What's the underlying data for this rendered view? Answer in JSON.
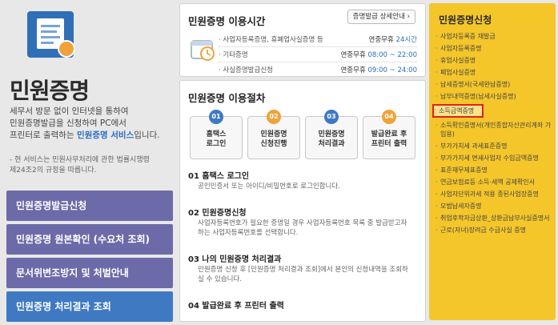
{
  "hero": {
    "title": "민원증명",
    "desc_1": "세무서 방문 없이 인터넷을 통하여",
    "desc_2": "민원증명발급을 신청하여 PC에서",
    "desc_3a": "프린터로 출력하는 ",
    "desc_3b": "민원증명 서비스",
    "desc_3c": "입니다.",
    "note_1": "- 현 서비스는 민원사무처리에 관한 법률시행령",
    "note_2": "  제24조2의 규정을 따릅니다."
  },
  "left_menu": [
    {
      "label": "민원증명발급신청"
    },
    {
      "label": "민원증명 원본확인 (수요처 조회)"
    },
    {
      "label": "문서위변조방지 및 처벌안내"
    },
    {
      "label": "민원증명 처리결과 조회"
    }
  ],
  "hours": {
    "title": "민원증명 이용시간",
    "detail_button": "증명발급 상세안내 ›",
    "rows": [
      {
        "label": "· 사업자등록증명, 휴폐업사실증명 등",
        "time_prefix": "연중무휴 ",
        "time": "24시간"
      },
      {
        "label": "· 기타증명",
        "time_prefix": "연중무휴 ",
        "time": "08:00 ~ 22:00"
      },
      {
        "label": "· 사실증명발급신청",
        "time_prefix": "연중무휴 ",
        "time": "09:00 ~ 24:00"
      }
    ]
  },
  "procedure": {
    "title": "민원증명 이용절차",
    "steps": [
      {
        "num": "01",
        "line1": "홈택스",
        "line2": "로그인"
      },
      {
        "num": "02",
        "line1": "민원증명",
        "line2": "신청진행"
      },
      {
        "num": "03",
        "line1": "민원증명",
        "line2": "처리결과"
      },
      {
        "num": "04",
        "line1": "발급완료 후",
        "line2": "프린터 출력"
      }
    ],
    "sections": [
      {
        "title": "01 홈택스 로그인",
        "body": "공인인증서 또는 아이디/비밀번호로 로그인합니다."
      },
      {
        "title": "02 민원증명신청",
        "body": "사업자등록번호가 필요한 증명일 경우 사업자등록번호 목록 중 발급받고자 하는 사업자등록번호를 선택합니다."
      },
      {
        "title": "03 나의 민원증명 처리결과",
        "body": "민원증명 신청 후 [민원증명 처리결과 조회]에서 본인의 신청내역을 조회하실 수 있습니다."
      },
      {
        "title": "04 발급완료 후 프린터 출력",
        "body": ""
      }
    ],
    "colors": {
      "step_blue": "#3f79c2",
      "step_orange": "#f0a23a"
    }
  },
  "right": {
    "title": "민원증명신청",
    "items": [
      "사업자등록증 재발급",
      "사업자등록증명",
      "휴업사실증명",
      "폐업사실증명",
      "납세증명서(국세완납증명)",
      "납부내역증명(납세사실증명)",
      "소득금액증명",
      "소득확인증명서(개인종합자산관리계좌 가입용)",
      "부가가치세 과세표준증명",
      "부가가치세 면세사업자 수입금액증명",
      "표준재무제표증명",
      "연금보험료등 소득·세액 공제확인서",
      "사업자단위과세 적용 종된사업장증명",
      "모범납세자증명",
      "취업후학자금상환_상환금납부사실증명서",
      "근로(자녀)장려금 수급사실 증명"
    ],
    "highlighted_index": 6
  },
  "colors": {
    "menu_purple": "#6c6aa8",
    "menu_blue": "#3f79c2",
    "right_bg": "#f4c62a",
    "highlight_border": "#e02020"
  }
}
